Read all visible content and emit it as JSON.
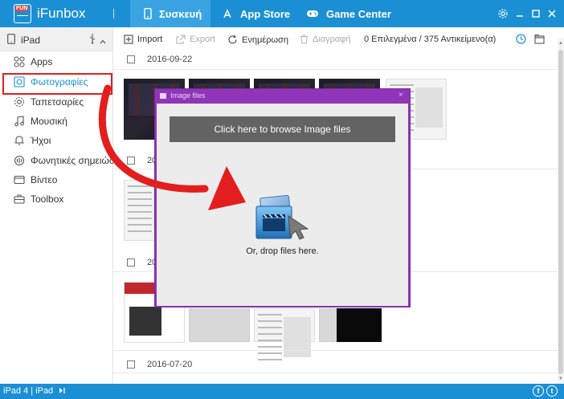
{
  "titlebar": {
    "logo_text": "FUN",
    "app_name": "iFunbox",
    "tabs": [
      {
        "label": "Συσκευή",
        "icon": "phone-icon",
        "active": true
      },
      {
        "label": "App Store",
        "icon": "app-store-icon",
        "active": false
      },
      {
        "label": "Game Center",
        "icon": "gamepad-icon",
        "active": false
      }
    ],
    "controls": [
      "gear-icon",
      "minimize-icon",
      "maximize-icon",
      "close-icon"
    ]
  },
  "sidebar": {
    "device": {
      "name": "iPad",
      "icon": "tablet-icon"
    },
    "items": [
      {
        "label": "Apps",
        "icon": "apps-icon",
        "active": false
      },
      {
        "label": "Φωτογραφίες",
        "icon": "photos-icon",
        "active": true
      },
      {
        "label": "Ταπετσαρίες",
        "icon": "wallpaper-icon",
        "active": false
      },
      {
        "label": "Μουσική",
        "icon": "music-icon",
        "active": false
      },
      {
        "label": "Ήχοι",
        "icon": "bell-icon",
        "active": false
      },
      {
        "label": "Φωνητικές σημειώσ...",
        "icon": "voice-memo-icon",
        "active": false
      },
      {
        "label": "Βίντεο",
        "icon": "video-icon",
        "active": false
      },
      {
        "label": "Toolbox",
        "icon": "toolbox-icon",
        "active": false
      }
    ]
  },
  "toolbar": {
    "import_label": "Import",
    "export_label": "Export",
    "refresh_label": "Ενημέρωση",
    "delete_label": "Διαγραφή",
    "selection_count": "0 Επιλεγμένα / 375 Αντικείμενο(α)"
  },
  "content": {
    "groups": [
      {
        "date": "2016-09-22"
      },
      {
        "date": "20"
      },
      {
        "date": "20"
      },
      {
        "date": "2016-07-20"
      }
    ]
  },
  "dialog": {
    "title": "Image files",
    "close_glyph": "×",
    "browse_label": "Click here to browse Image files",
    "drop_text": "Or, drop files here."
  },
  "statusbar": {
    "device_label": "iPad 4 | iPad",
    "social": [
      "f",
      "t"
    ]
  },
  "colors": {
    "accent": "#1b8fd4",
    "active_tab": "#3aa4e2",
    "dialog_border": "#9035b8",
    "annotation_red": "#e31e1e"
  }
}
